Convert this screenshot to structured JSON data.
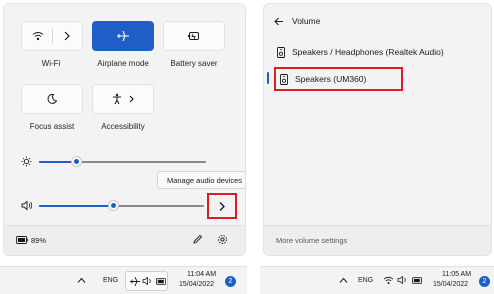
{
  "left": {
    "tiles": {
      "wifi_label": "Wi-Fi",
      "airplane_label": "Airplane mode",
      "battery_saver_label": "Battery saver",
      "focus_label": "Focus assist",
      "accessibility_label": "Accessibility"
    },
    "brightness_level": 0.22,
    "volume_level": 0.45,
    "tooltip": "Manage audio devices",
    "battery_percent": "89%",
    "taskbar": {
      "lang": "ENG",
      "time": "11:04 AM",
      "date": "15/04/2022",
      "badge": "2"
    }
  },
  "right": {
    "title": "Volume",
    "devices": [
      {
        "label": "Speakers / Headphones (Realtek Audio)"
      },
      {
        "label": "Speakers (UM360)"
      }
    ],
    "footer_label": "More volume settings",
    "taskbar": {
      "lang": "ENG",
      "time": "11:05 AM",
      "date": "15/04/2022",
      "badge": "2"
    }
  },
  "colors": {
    "accent": "#1f5ec6",
    "highlight_box": "#e11c1c"
  }
}
